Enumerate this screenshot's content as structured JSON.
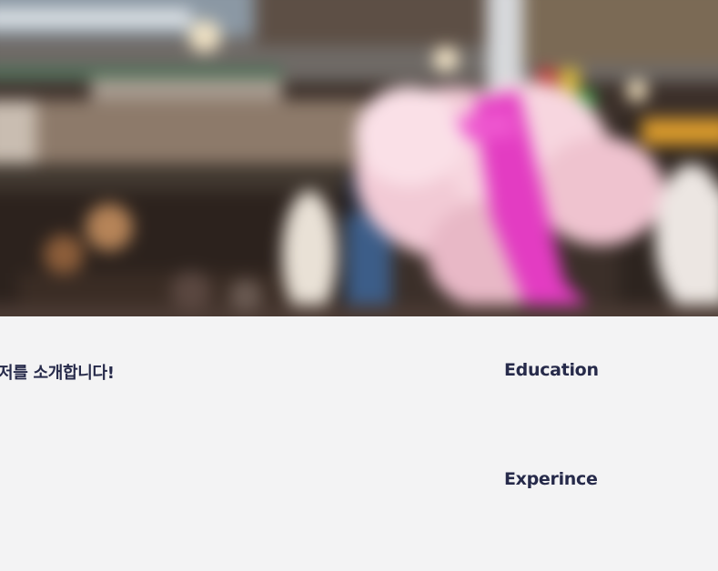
{
  "hero": {
    "image_alt": "blurred indoor market with pink blossom decoration"
  },
  "intro": {
    "title": "저를 소개합니다!"
  },
  "sections": {
    "education": "Education",
    "experience": "Experince"
  },
  "colors": {
    "background": "#f3f3f4",
    "heading": "#262a4a"
  }
}
